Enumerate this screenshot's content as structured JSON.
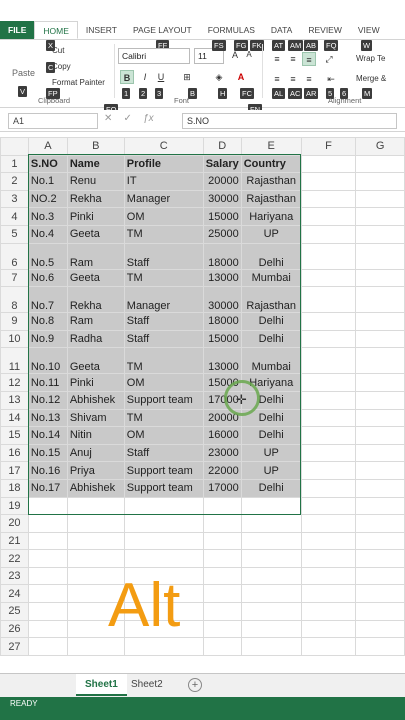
{
  "ribbon_tabs": [
    "FILE",
    "HOME",
    "INSERT",
    "PAGE LAYOUT",
    "FORMULAS",
    "DATA",
    "REVIEW",
    "VIEW"
  ],
  "keytips": {
    "x": "X",
    "c": "C",
    "v": "V",
    "fp": "FP",
    "ff": "FF",
    "fs": "FS",
    "fg": "FG",
    "fk": "FK",
    "at": "AT",
    "am": "AM",
    "ab": "AB",
    "fq": "FQ",
    "w": "W",
    "fo": "FO",
    "n1": "1",
    "n2": "2",
    "n3": "3",
    "b": "B",
    "h": "H",
    "fc": "FC",
    "al": "AL",
    "ac": "AC",
    "ar": "AR",
    "n5": "5",
    "n6": "6",
    "m": "M",
    "fn": "FN"
  },
  "clipboard": {
    "cut": "Cut",
    "copy": "Copy",
    "painter": "Format Painter",
    "paste": "Paste",
    "group": "Clipboard"
  },
  "font": {
    "name": "Calibri",
    "size": "11",
    "bold": "B",
    "italic": "I",
    "underline": "U",
    "grow": "A",
    "shrink": "A",
    "group": "Font"
  },
  "alignment": {
    "wrap": "Wrap Te",
    "merge": "Merge &",
    "group": "Alignment"
  },
  "formula_bar": {
    "cell_ref": "A1",
    "content": "S.NO"
  },
  "columns": [
    "A",
    "B",
    "C",
    "D",
    "E",
    "F",
    "G"
  ],
  "rows": [
    {
      "n": "1",
      "tall": false,
      "cells": [
        "S.NO",
        "Name",
        "Profile",
        "Salary",
        "Country"
      ]
    },
    {
      "n": "2",
      "tall": false,
      "cells": [
        "No.1",
        "Renu",
        "IT",
        "20000",
        "Rajasthan"
      ]
    },
    {
      "n": "3",
      "tall": false,
      "cells": [
        "NO.2",
        "Rekha",
        "Manager",
        "30000",
        "Rajasthan"
      ]
    },
    {
      "n": "4",
      "tall": false,
      "cells": [
        "No.3",
        "Pinki",
        "OM",
        "15000",
        "Hariyana"
      ]
    },
    {
      "n": "5",
      "tall": false,
      "cells": [
        "No.4",
        "Geeta",
        "TM",
        "25000",
        "UP"
      ]
    },
    {
      "n": "6",
      "tall": true,
      "cells": [
        "No.5",
        "Ram",
        "Staff",
        "18000",
        "Delhi"
      ]
    },
    {
      "n": "7",
      "tall": false,
      "cells": [
        "No.6",
        "Geeta",
        "TM",
        "13000",
        "Mumbai"
      ]
    },
    {
      "n": "8",
      "tall": true,
      "cells": [
        "No.7",
        "Rekha",
        "Manager",
        "30000",
        "Rajasthan"
      ]
    },
    {
      "n": "9",
      "tall": false,
      "cells": [
        "No.8",
        "Ram",
        "Staff",
        "18000",
        "Delhi"
      ]
    },
    {
      "n": "10",
      "tall": false,
      "cells": [
        "No.9",
        "Radha",
        "Staff",
        "15000",
        "Delhi"
      ]
    },
    {
      "n": "11",
      "tall": true,
      "cells": [
        "No.10",
        "Geeta",
        "TM",
        "13000",
        "Mumbai"
      ]
    },
    {
      "n": "12",
      "tall": false,
      "cells": [
        "No.11",
        "Pinki",
        "OM",
        "15000",
        "Hariyana"
      ]
    },
    {
      "n": "13",
      "tall": false,
      "cells": [
        "No.12",
        "Abhishek",
        "Support team",
        "17000",
        "Delhi"
      ]
    },
    {
      "n": "14",
      "tall": false,
      "cells": [
        "No.13",
        "Shivam",
        "TM",
        "20000",
        "Delhi"
      ]
    },
    {
      "n": "15",
      "tall": false,
      "cells": [
        "No.14",
        "Nitin",
        "OM",
        "16000",
        "Delhi"
      ]
    },
    {
      "n": "16",
      "tall": false,
      "cells": [
        "No.15",
        "Anuj",
        "Staff",
        "23000",
        "UP"
      ]
    },
    {
      "n": "17",
      "tall": false,
      "cells": [
        "No.16",
        "Priya",
        "Support team",
        "22000",
        "UP"
      ]
    },
    {
      "n": "18",
      "tall": false,
      "cells": [
        "No.17",
        "Abhishek",
        "Support team",
        "17000",
        "Delhi"
      ]
    },
    {
      "n": "19",
      "tall": false,
      "cells": [
        "",
        "",
        "",
        "",
        ""
      ]
    },
    {
      "n": "20",
      "tall": false,
      "cells": [
        "",
        "",
        "",
        "",
        ""
      ]
    },
    {
      "n": "21",
      "tall": false,
      "cells": [
        "",
        "",
        "",
        "",
        ""
      ]
    },
    {
      "n": "22",
      "tall": false,
      "cells": [
        "",
        "",
        "",
        "",
        ""
      ]
    },
    {
      "n": "23",
      "tall": false,
      "cells": [
        "",
        "",
        "",
        "",
        ""
      ]
    },
    {
      "n": "24",
      "tall": false,
      "cells": [
        "",
        "",
        "",
        "",
        ""
      ]
    },
    {
      "n": "25",
      "tall": false,
      "cells": [
        "",
        "",
        "",
        "",
        ""
      ]
    },
    {
      "n": "26",
      "tall": false,
      "cells": [
        "",
        "",
        "",
        "",
        ""
      ]
    },
    {
      "n": "27",
      "tall": false,
      "cells": [
        "",
        "",
        "",
        "",
        ""
      ]
    }
  ],
  "overlay_text": "Alt",
  "sheets": [
    "Sheet1",
    "Sheet2"
  ],
  "add_sheet": "+",
  "status": "READY",
  "colors": {
    "accent": "#217346",
    "overlay": "#f39c12",
    "selection": "#c9c9c9"
  }
}
